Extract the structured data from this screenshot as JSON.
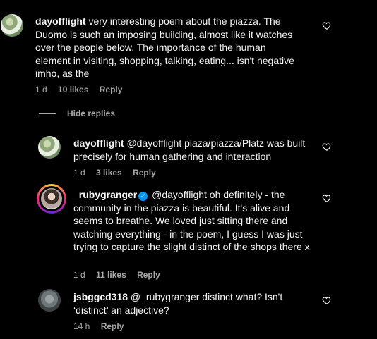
{
  "comments": [
    {
      "username": "dayofflight",
      "text": "very interesting poem about the piazza. The Duomo is such an imposing building, almost like it watches over the people below. The importance of the human element in visiting, shopping, talking, eating... isn't negative imho, as the",
      "time": "1 d",
      "likes": "10 likes",
      "reply": "Reply"
    },
    {
      "username": "dayofflight",
      "text": "@dayofflight plaza/piazza/Platz was built precisely for human gathering and interaction",
      "time": "1 d",
      "likes": "3 likes",
      "reply": "Reply"
    },
    {
      "username": "_rubygranger",
      "text": "@dayofflight oh definitely - the community in the piazza is beautiful. It's alive and seems to breathe. We loved just sitting there and watching everything - in the poem, I guess I was just trying to capture the slight distinct of the shops there x",
      "time": "1 d",
      "likes": "11 likes",
      "reply": "Reply",
      "verified": true
    },
    {
      "username": "jsbggcd318",
      "text": "@_rubygranger distinct what? Isn't ‘distinct’ an adjective?",
      "time": "14 h",
      "reply": "Reply"
    }
  ],
  "hide_replies_label": "Hide replies",
  "icons": {
    "like": "heart-icon",
    "verified": "verified-badge-icon"
  },
  "colors": {
    "background": "#000000",
    "text": "#f5f5f5",
    "meta": "#a8a8a8",
    "verified": "#0095f6"
  }
}
